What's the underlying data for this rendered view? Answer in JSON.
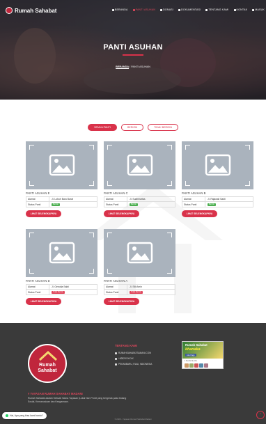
{
  "brand": {
    "name": "Rumah Sahabat"
  },
  "nav": {
    "items": [
      {
        "label": "BERANDA"
      },
      {
        "label": "PANTI ASUHAN"
      },
      {
        "label": "DONASI"
      },
      {
        "label": "DOKUMENTASI"
      },
      {
        "label": "TENTANG KAMI"
      },
      {
        "label": "KONTAK"
      },
      {
        "label": "MASUK"
      }
    ]
  },
  "hero": {
    "title": "PANTI ASUHAN",
    "crumb_home": "BERANDA",
    "crumb_sep": "/",
    "crumb_current": "PANTI ASUHAN"
  },
  "filters": [
    {
      "label": "SEMUA PANTI"
    },
    {
      "label": "BERIZIN"
    },
    {
      "label": "TIDAK BERIZIN"
    }
  ],
  "cards": [
    {
      "title": "PANTI ASUHAN E",
      "address": "Jl. Lobuh Baru Barat",
      "status": "Berizin"
    },
    {
      "title": "PANTI ASUHAN C",
      "address": "Jl. Sudirmartas",
      "status": "Berizin"
    },
    {
      "title": "PANTI ASUHAN B",
      "address": "Jl. Rajawali Sakti",
      "status": "Berizin"
    },
    {
      "title": "PANTI ASUHAN D",
      "address": "Jl. Gerudia Sakti",
      "status": "Tidak Berizin"
    },
    {
      "title": "PANTI ASUHAN A",
      "address": "Jl. SM Amin",
      "status": "Tidak Berizin"
    }
  ],
  "card_labels": {
    "address": "Alamat",
    "status": "Status Panti",
    "button": "LIHAT SELENGKAPNYA"
  },
  "footer": {
    "logo_line1": "Rumah",
    "logo_line2": "Sahabat",
    "section_title": "# YAYASAN RUMAH SAHABAT MADANI",
    "description": "Rumah Sahabat adalah Sebuah Nama Yayasan (Lokal Non Provit yang bergerak pada bidang Sosial, Kemanusiaan dan Keagamaan.",
    "contact_title": "TENTANG KAMI",
    "contacts": [
      {
        "text": "RUMAHSAHABATSAMANI.COM"
      },
      {
        "text": "+6282XXXXXX"
      },
      {
        "text": "PEKANBARU, RIAU, INDONESIA"
      }
    ],
    "fb": {
      "name": "Rumah Sahabat",
      "sub": "khanaka",
      "like": "Like Page",
      "friends": "1 friends like this"
    },
    "copyright": "© 2020 - Yayasan Rumah Sahabat Madani"
  },
  "chat": {
    "label": "Hai, Apa yang bisa kami bantu?"
  },
  "colors": {
    "accent": "#d9324a",
    "footer": "#3a3a3a"
  }
}
